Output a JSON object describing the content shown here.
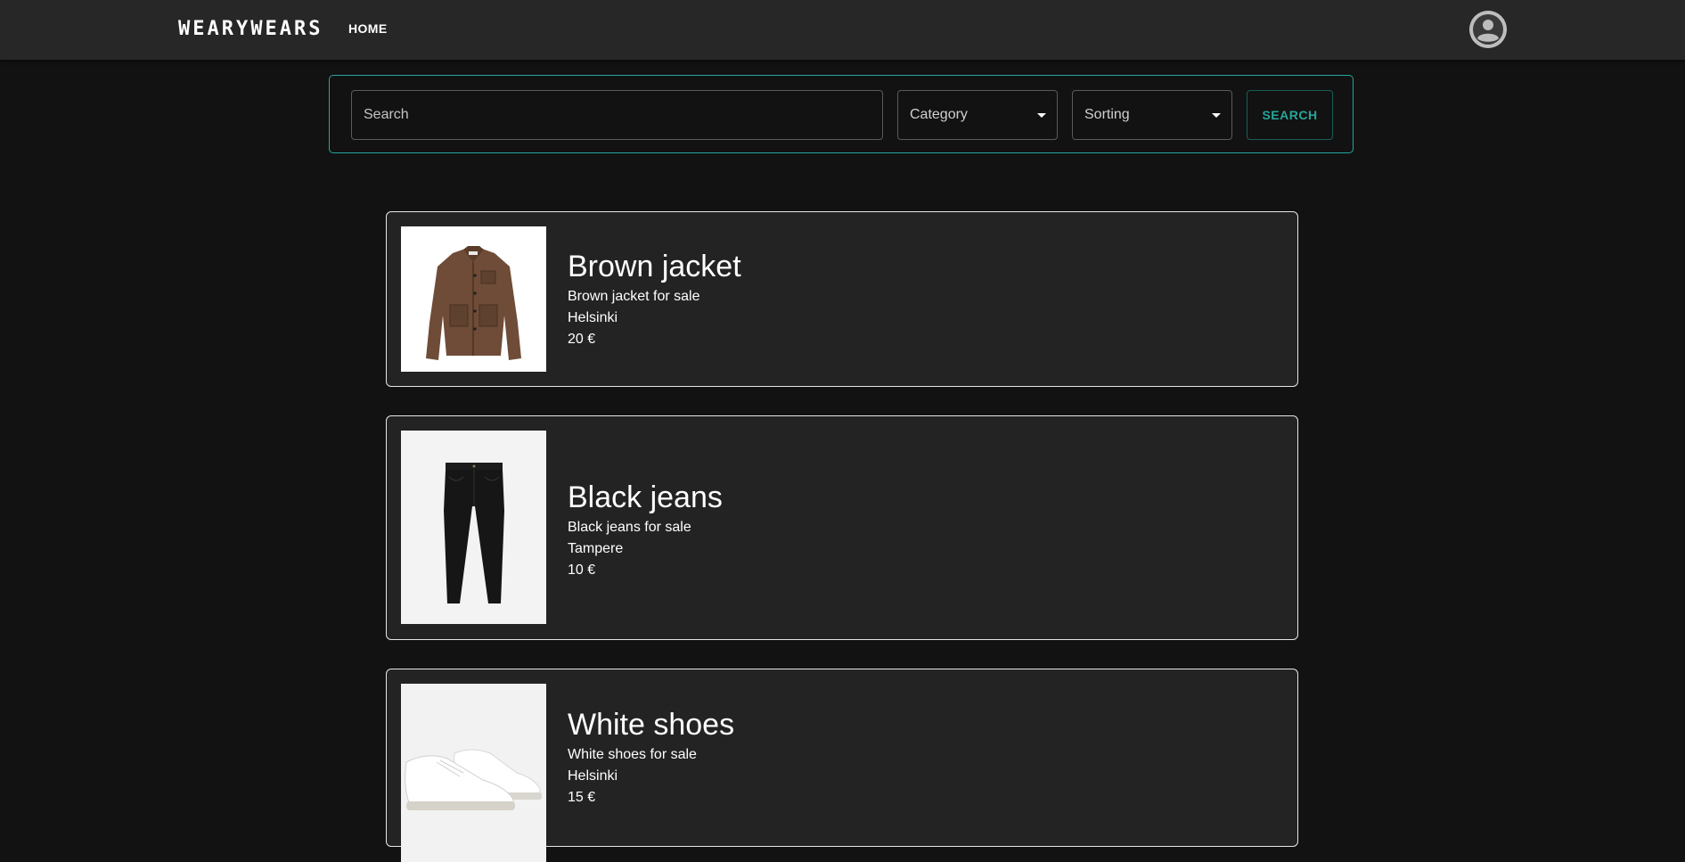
{
  "header": {
    "brand": "WEARYWEARS",
    "nav_home": "HOME"
  },
  "search": {
    "placeholder": "Search",
    "category_label": "Category",
    "sorting_label": "Sorting",
    "button_label": "SEARCH"
  },
  "colors": {
    "accent": "#26a69a",
    "background": "#121212",
    "appbar": "#272727",
    "card": "#232323"
  },
  "listings": [
    {
      "title": "Brown jacket",
      "description": "Brown jacket for sale",
      "location": "Helsinki",
      "price": "20 €",
      "image_icon": "brown-jacket-image"
    },
    {
      "title": "Black jeans",
      "description": "Black jeans for sale",
      "location": "Tampere",
      "price": "10 €",
      "image_icon": "black-jeans-image"
    },
    {
      "title": "White shoes",
      "description": "White shoes for sale",
      "location": "Helsinki",
      "price": "15 €",
      "image_icon": "white-shoes-image"
    }
  ]
}
